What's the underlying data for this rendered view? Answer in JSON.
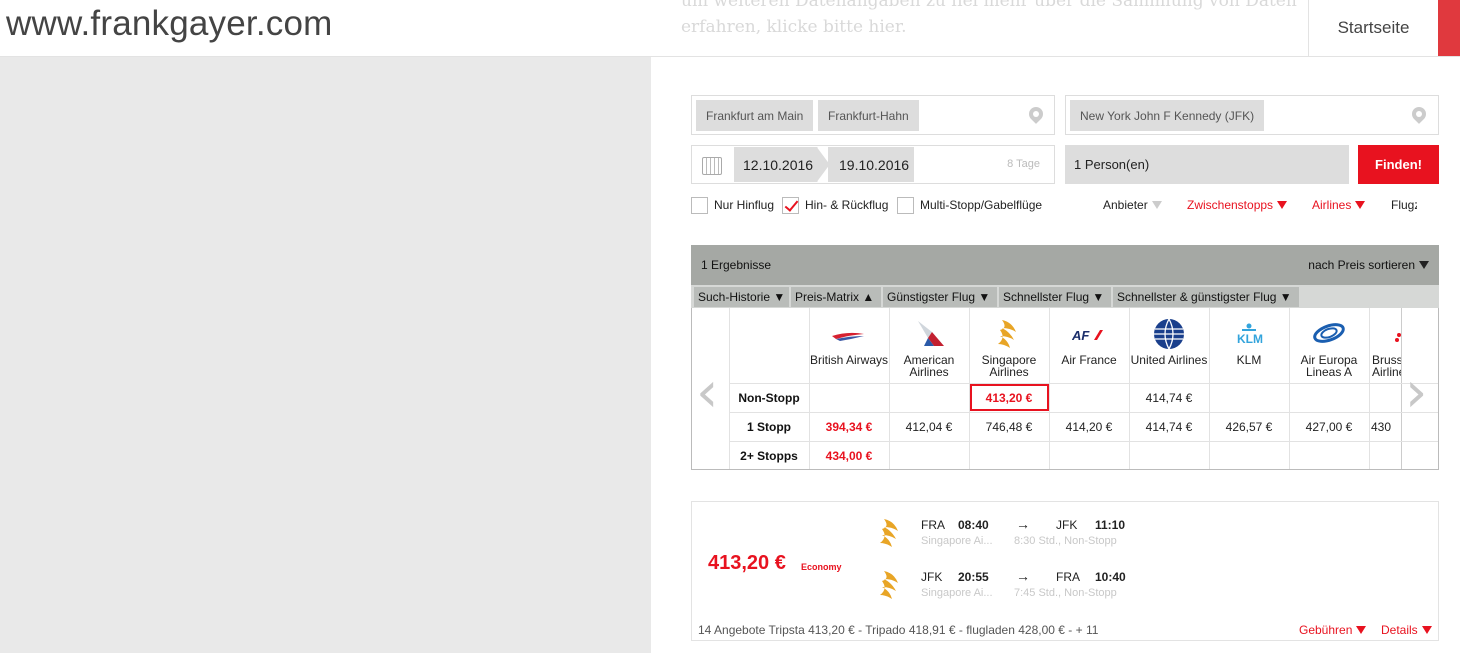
{
  "site": {
    "title": "www.frankgayer.com",
    "bg_text_line1": "um weiteren Datenangaben zu fiel mehr über die Sammlung von Daten zu",
    "bg_text_line2": "erfahren, klicke bitte hier."
  },
  "nav": {
    "home_label": "Startseite"
  },
  "search": {
    "origins": [
      "Frankfurt am Main",
      "Frankfurt-Hahn"
    ],
    "destinations": [
      "New York John F Kennedy (JFK)"
    ],
    "date_out": "12.10.2016",
    "date_back": "19.10.2016",
    "duration": "8 Tage",
    "persons": "1 Person(en)",
    "find_label": "Finden!"
  },
  "trip_types": {
    "oneway": "Nur Hinflug",
    "roundtrip": "Hin- & Rückflug",
    "multi": "Multi-Stopp/Gabelflüge"
  },
  "filters": {
    "provider": "Anbieter",
    "stops": "Zwischenstopps",
    "airlines": "Airlines",
    "times": "Flugz"
  },
  "results": {
    "count": "1 Ergebnisse",
    "sort": "nach Preis sortieren",
    "tabs": [
      "Such-Historie ▼",
      "Preis-Matrix ▲",
      "Günstigster Flug ▼",
      "Schnellster Flug ▼",
      "Schnellster & günstigster Flug ▼"
    ]
  },
  "matrix": {
    "airlines": [
      {
        "name": "British Airways",
        "icon": "british-airways-logo-icon"
      },
      {
        "name": "American Airlines",
        "icon": "american-airlines-logo-icon"
      },
      {
        "name": "Singapore Airlines",
        "icon": "singapore-airlines-logo-icon"
      },
      {
        "name": "Air France",
        "icon": "air-france-logo-icon"
      },
      {
        "name": "United Airlines",
        "icon": "united-airlines-logo-icon"
      },
      {
        "name": "KLM",
        "icon": "klm-logo-icon"
      },
      {
        "name": "Air Europa Lineas A",
        "icon": "air-europa-logo-icon"
      },
      {
        "name": "Brussels Airlines",
        "icon": "brussels-airlines-logo-icon"
      }
    ],
    "rows": [
      {
        "label": "Non-Stopp",
        "values": [
          "",
          "",
          "413,20 €",
          "",
          "414,74 €",
          "",
          "",
          ""
        ]
      },
      {
        "label": "1 Stopp",
        "values": [
          "394,34 €",
          "412,04 €",
          "746,48 €",
          "414,20 €",
          "414,74 €",
          "426,57 €",
          "427,00 €",
          "430"
        ]
      },
      {
        "label": "2+ Stopps",
        "values": [
          "434,00 €",
          "",
          "",
          "",
          "",
          "",
          "",
          ""
        ]
      }
    ],
    "colors": {
      "accent": "#e8121f"
    }
  },
  "flight": {
    "price": "413,20 €",
    "class": "Economy",
    "outbound": {
      "from": "FRA",
      "dep": "08:40",
      "to": "JFK",
      "arr": "11:10",
      "airline": "Singapore Ai...",
      "info": "8:30 Std., Non-Stopp"
    },
    "inbound": {
      "from": "JFK",
      "dep": "20:55",
      "to": "FRA",
      "arr": "10:40",
      "airline": "Singapore Ai...",
      "info": "7:45 Std., Non-Stopp"
    },
    "arrow": "→",
    "footer": "14 Angebote   Tripsta 413,20 € -   Tripado 418,91 € -   flugladen 428,00 € -   + 11",
    "fees": "Gebühren",
    "details": "Details"
  }
}
